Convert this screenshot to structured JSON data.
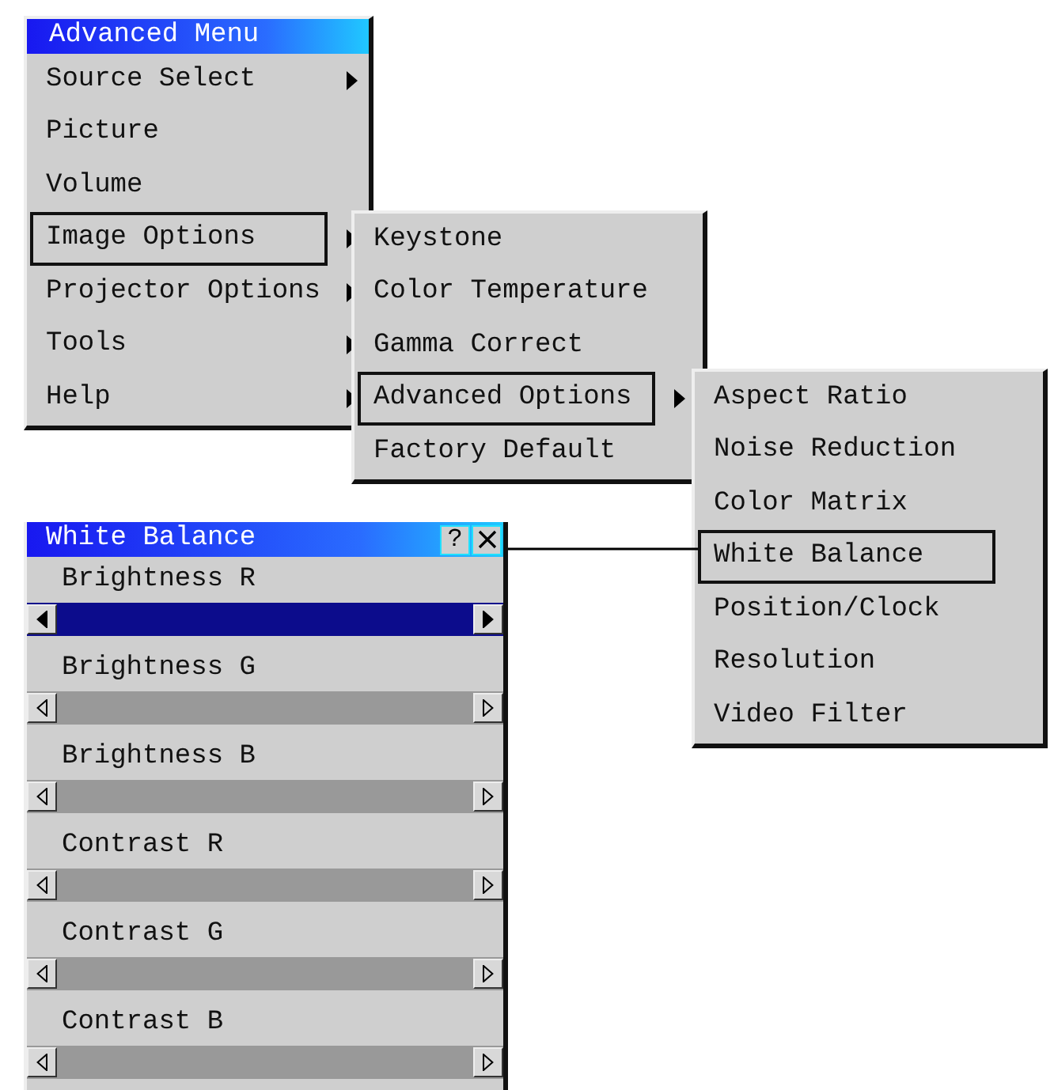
{
  "menus": [
    {
      "title": "Advanced Menu",
      "items": [
        {
          "label": "Source Select",
          "submenu": true,
          "selected": false
        },
        {
          "label": "Picture",
          "submenu": false,
          "selected": false
        },
        {
          "label": "Volume",
          "submenu": false,
          "selected": false
        },
        {
          "label": "Image Options",
          "submenu": true,
          "selected": true
        },
        {
          "label": "Projector Options",
          "submenu": true,
          "selected": false
        },
        {
          "label": "Tools",
          "submenu": true,
          "selected": false
        },
        {
          "label": "Help",
          "submenu": true,
          "selected": false
        }
      ]
    },
    {
      "items": [
        {
          "label": "Keystone",
          "submenu": false,
          "selected": false
        },
        {
          "label": "Color Temperature",
          "submenu": false,
          "selected": false
        },
        {
          "label": "Gamma Correct",
          "submenu": false,
          "selected": false
        },
        {
          "label": "Advanced Options",
          "submenu": true,
          "selected": true
        },
        {
          "label": "Factory Default",
          "submenu": false,
          "selected": false
        }
      ]
    },
    {
      "items": [
        {
          "label": "Aspect Ratio",
          "submenu": false,
          "selected": false
        },
        {
          "label": "Noise Reduction",
          "submenu": false,
          "selected": false
        },
        {
          "label": "Color Matrix",
          "submenu": false,
          "selected": false
        },
        {
          "label": "White Balance",
          "submenu": false,
          "selected": true
        },
        {
          "label": "Position/Clock",
          "submenu": false,
          "selected": false
        },
        {
          "label": "Resolution",
          "submenu": false,
          "selected": false
        },
        {
          "label": "Video Filter",
          "submenu": false,
          "selected": false
        }
      ]
    }
  ],
  "dialog": {
    "title": "White Balance",
    "help_button": "?",
    "sliders": [
      {
        "label": "Brightness R",
        "selected": true
      },
      {
        "label": "Brightness G",
        "selected": false
      },
      {
        "label": "Brightness B",
        "selected": false
      },
      {
        "label": "Contrast R",
        "selected": false
      },
      {
        "label": "Contrast G",
        "selected": false
      },
      {
        "label": "Contrast B",
        "selected": false
      }
    ]
  }
}
